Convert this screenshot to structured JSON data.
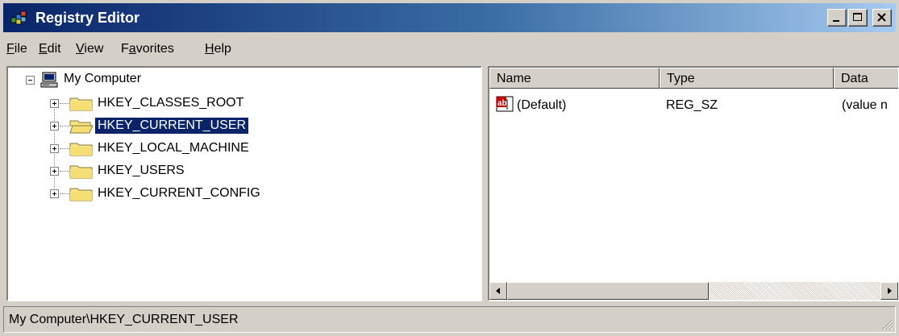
{
  "window": {
    "title": "Registry Editor",
    "title_bar_start_color": "#0a246a",
    "title_bar_end_color": "#a6caf0"
  },
  "title_buttons": {
    "minimize_icon": "minimize-icon",
    "maximize_icon": "maximize-icon",
    "close_icon": "close-icon"
  },
  "menu": {
    "items": [
      {
        "label": "File",
        "accel": "F",
        "rest": "ile"
      },
      {
        "label": "Edit",
        "accel": "E",
        "rest": "dit"
      },
      {
        "label": "View",
        "accel": "V",
        "rest": "iew"
      },
      {
        "label": "Favorites",
        "pre": "F",
        "accel": "a",
        "rest": "vorites"
      },
      {
        "label": "Help",
        "accel": "H",
        "rest": "elp"
      }
    ]
  },
  "tree": {
    "root": {
      "label": "My Computer",
      "icon": "computer-icon",
      "expanded": true
    },
    "children": [
      {
        "label": "HKEY_CLASSES_ROOT",
        "selected": false
      },
      {
        "label": "HKEY_CURRENT_USER",
        "selected": true
      },
      {
        "label": "HKEY_LOCAL_MACHINE",
        "selected": false
      },
      {
        "label": "HKEY_USERS",
        "selected": false
      },
      {
        "label": "HKEY_CURRENT_CONFIG",
        "selected": false
      }
    ],
    "selection_color": "#0a246a"
  },
  "list": {
    "columns": [
      "Name",
      "Type",
      "Data"
    ],
    "rows": [
      {
        "name": "(Default)",
        "type": "REG_SZ",
        "data": "(value n",
        "icon": "string-value-icon"
      }
    ]
  },
  "status": {
    "path": "My Computer\\HKEY_CURRENT_USER"
  }
}
